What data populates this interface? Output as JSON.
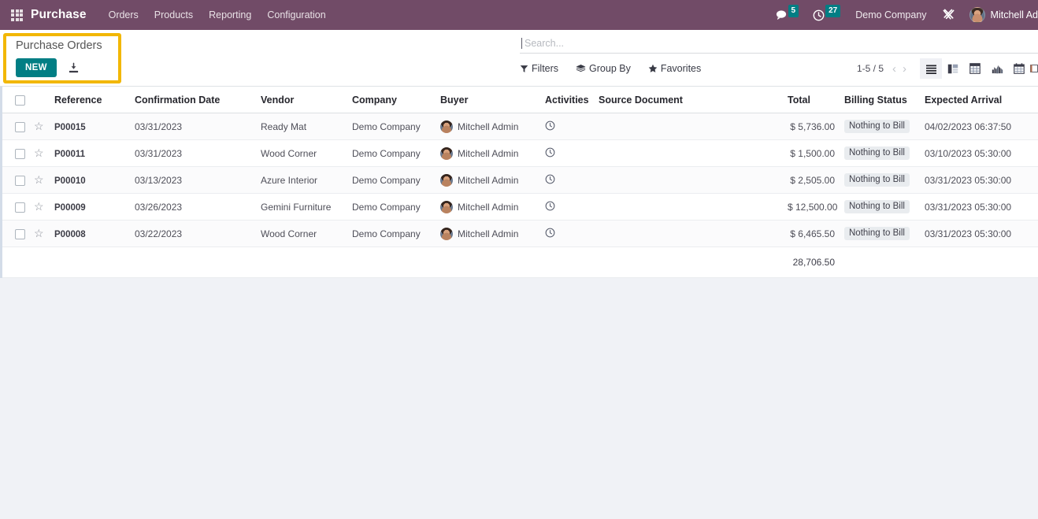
{
  "navbar": {
    "apps_icon": "apps-grid-icon",
    "brand": "Purchase",
    "menu": [
      {
        "label": "Orders"
      },
      {
        "label": "Products"
      },
      {
        "label": "Reporting"
      },
      {
        "label": "Configuration"
      }
    ],
    "messages_icon": "chat-bubble-icon",
    "messages_count": "5",
    "activities_icon": "clock-icon",
    "activities_count": "27",
    "company": "Demo Company",
    "tools_icon": "wrench-screwdriver-icon",
    "user_name": "Mitchell Ad",
    "accent_teal": "#017e84",
    "navbar_purple": "#714B67"
  },
  "control_panel": {
    "breadcrumb": "Purchase Orders",
    "new_label": "NEW",
    "import_icon": "import-download-icon",
    "highlight_color": "#f2b705"
  },
  "search": {
    "placeholder": "Search...",
    "value": ""
  },
  "toolbar": {
    "filters_label": "Filters",
    "filters_icon": "funnel-icon",
    "groupby_label": "Group By",
    "groupby_icon": "layers-icon",
    "favorites_label": "Favorites",
    "favorites_icon": "star-icon",
    "pager_count": "1-5 / 5",
    "prev_icon": "chevron-left-icon",
    "next_icon": "chevron-right-icon",
    "views": [
      {
        "name": "list-view",
        "icon": "list-icon",
        "active": true
      },
      {
        "name": "kanban-view",
        "icon": "kanban-icon",
        "active": false
      },
      {
        "name": "pivot-view",
        "icon": "pivot-table-icon",
        "active": false
      },
      {
        "name": "graph-view",
        "icon": "graph-chart-icon",
        "active": false
      },
      {
        "name": "calendar-view",
        "icon": "calendar-icon",
        "active": false
      },
      {
        "name": "activity-view",
        "icon": "activity-icon",
        "active": false
      }
    ]
  },
  "table": {
    "columns": [
      "Reference",
      "Confirmation Date",
      "Vendor",
      "Company",
      "Buyer",
      "Activities",
      "Source Document",
      "Total",
      "Billing Status",
      "Expected Arrival"
    ],
    "rows": [
      {
        "reference": "P00015",
        "confirmation_date": "03/31/2023",
        "vendor": "Ready Mat",
        "company": "Demo Company",
        "buyer": "Mitchell Admin",
        "activity_icon": "clock-icon",
        "source_document": "",
        "total": "$ 5,736.00",
        "billing_status": "Nothing to Bill",
        "expected_arrival": "04/02/2023 06:37:50"
      },
      {
        "reference": "P00011",
        "confirmation_date": "03/31/2023",
        "vendor": "Wood Corner",
        "company": "Demo Company",
        "buyer": "Mitchell Admin",
        "activity_icon": "clock-icon",
        "source_document": "",
        "total": "$ 1,500.00",
        "billing_status": "Nothing to Bill",
        "expected_arrival": "03/10/2023 05:30:00"
      },
      {
        "reference": "P00010",
        "confirmation_date": "03/13/2023",
        "vendor": "Azure Interior",
        "company": "Demo Company",
        "buyer": "Mitchell Admin",
        "activity_icon": "clock-icon",
        "source_document": "",
        "total": "$ 2,505.00",
        "billing_status": "Nothing to Bill",
        "expected_arrival": "03/31/2023 05:30:00"
      },
      {
        "reference": "P00009",
        "confirmation_date": "03/26/2023",
        "vendor": "Gemini Furniture",
        "company": "Demo Company",
        "buyer": "Mitchell Admin",
        "activity_icon": "clock-icon",
        "source_document": "",
        "total": "$ 12,500.00",
        "billing_status": "Nothing to Bill",
        "expected_arrival": "03/31/2023 05:30:00"
      },
      {
        "reference": "P00008",
        "confirmation_date": "03/22/2023",
        "vendor": "Wood Corner",
        "company": "Demo Company",
        "buyer": "Mitchell Admin",
        "activity_icon": "clock-icon",
        "source_document": "",
        "total": "$ 6,465.50",
        "billing_status": "Nothing to Bill",
        "expected_arrival": "03/31/2023 05:30:00"
      }
    ],
    "total_sum": "28,706.50"
  }
}
